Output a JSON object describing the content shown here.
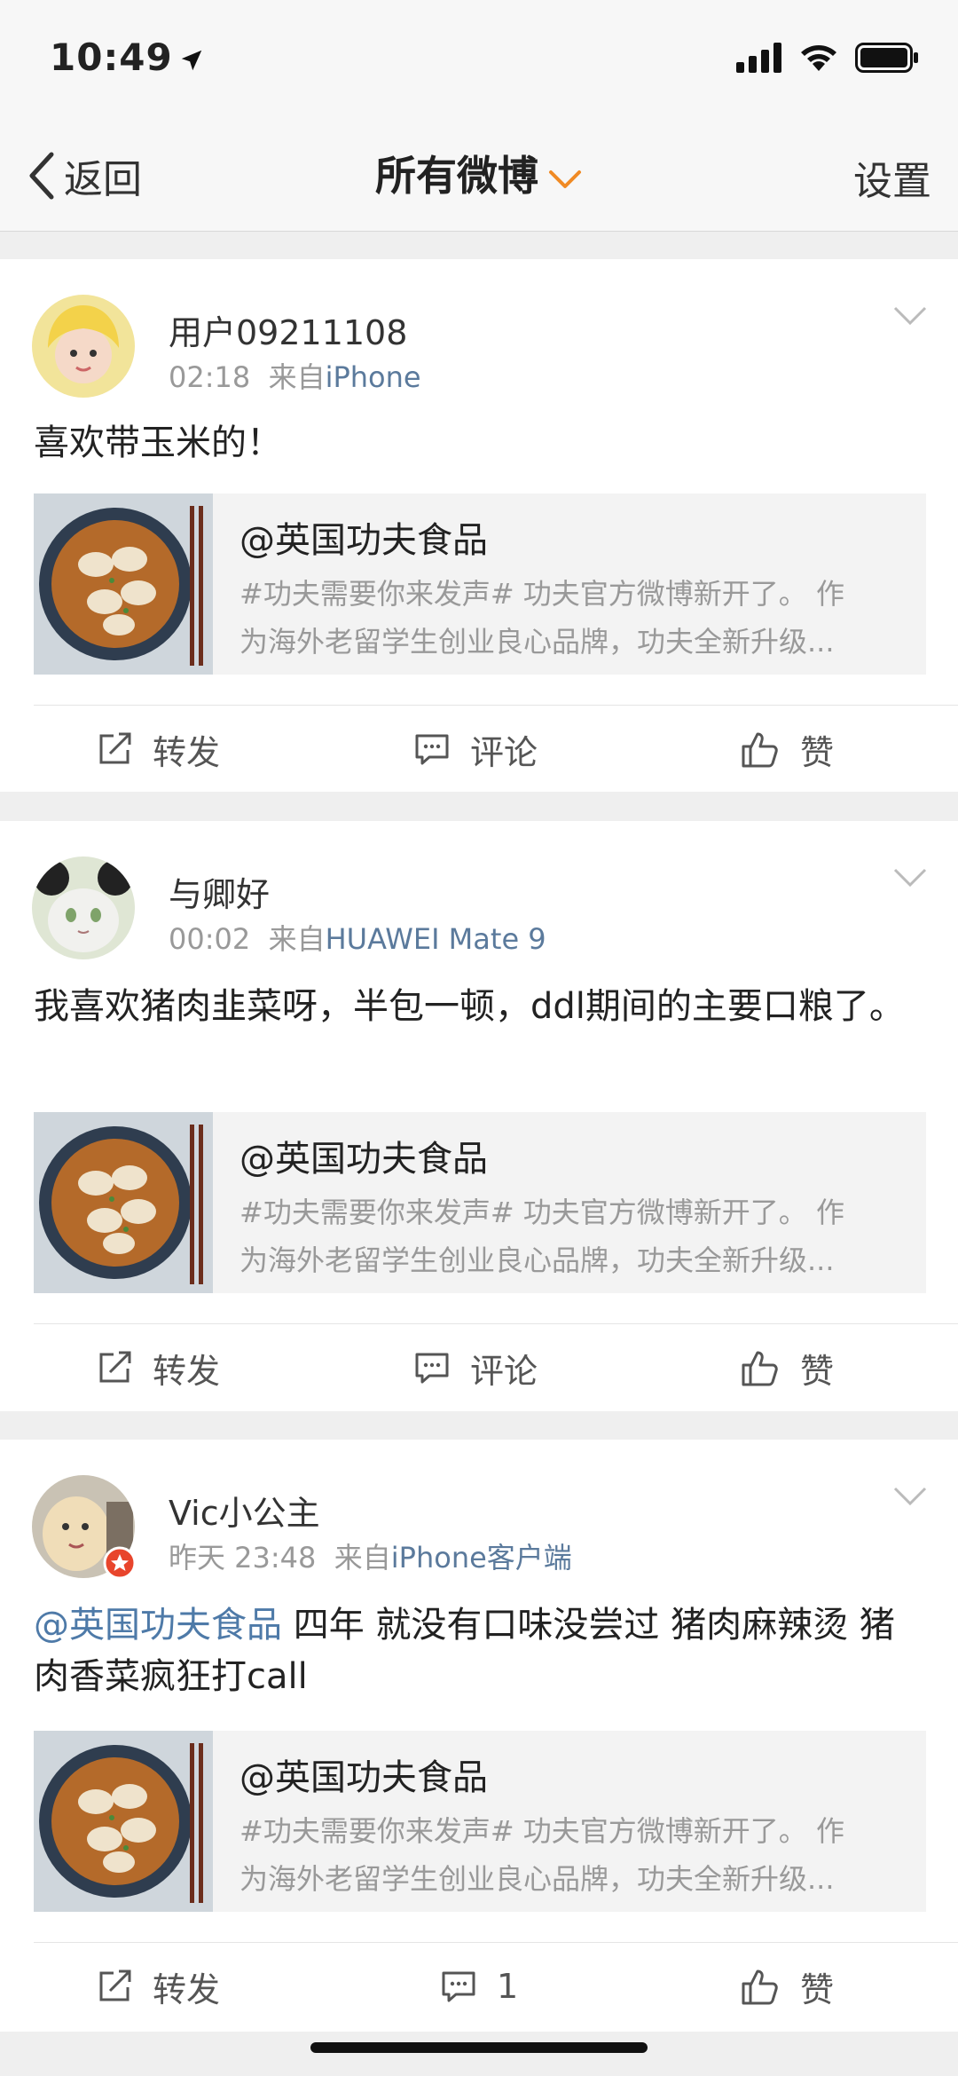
{
  "status_bar": {
    "time": "10:49"
  },
  "nav": {
    "back_label": "返回",
    "title": "所有微博",
    "settings_label": "设置"
  },
  "posts": [
    {
      "username": "用户09211108",
      "time": "02:18",
      "source_prefix": "来自",
      "source": "iPhone",
      "text": "喜欢带玉米的！",
      "card": {
        "title": "@英国功夫食品",
        "desc_line1": "#功夫需要你来发声#   功夫官方微博新开了。 作",
        "desc_line2": "为海外老留学生创业良心品牌，功夫全新升级..."
      },
      "actions": {
        "repost": "转发",
        "comment": "评论",
        "like": "赞"
      }
    },
    {
      "username": "与卿好",
      "time": "00:02",
      "source_prefix": "来自",
      "source": "HUAWEI Mate 9",
      "text": "我喜欢猪肉韭菜呀，半包一顿，ddl期间的主要口粮了。",
      "card": {
        "title": "@英国功夫食品",
        "desc_line1": "#功夫需要你来发声#   功夫官方微博新开了。 作",
        "desc_line2": "为海外老留学生创业良心品牌，功夫全新升级..."
      },
      "actions": {
        "repost": "转发",
        "comment": "评论",
        "like": "赞"
      }
    },
    {
      "username": "Vic小公主",
      "time": "昨天 23:48",
      "source_prefix": "来自",
      "source": "iPhone客户端",
      "text_mention": "@英国功夫食品",
      "text": " 四年 就没有口味没尝过 猪肉麻辣烫 猪肉香菜疯狂打call",
      "card": {
        "title": "@英国功夫食品",
        "desc_line1": "#功夫需要你来发声#   功夫官方微博新开了。 作",
        "desc_line2": "为海外老留学生创业良心品牌，功夫全新升级..."
      },
      "actions": {
        "repost": "转发",
        "comment": "1",
        "like": "赞"
      }
    }
  ]
}
